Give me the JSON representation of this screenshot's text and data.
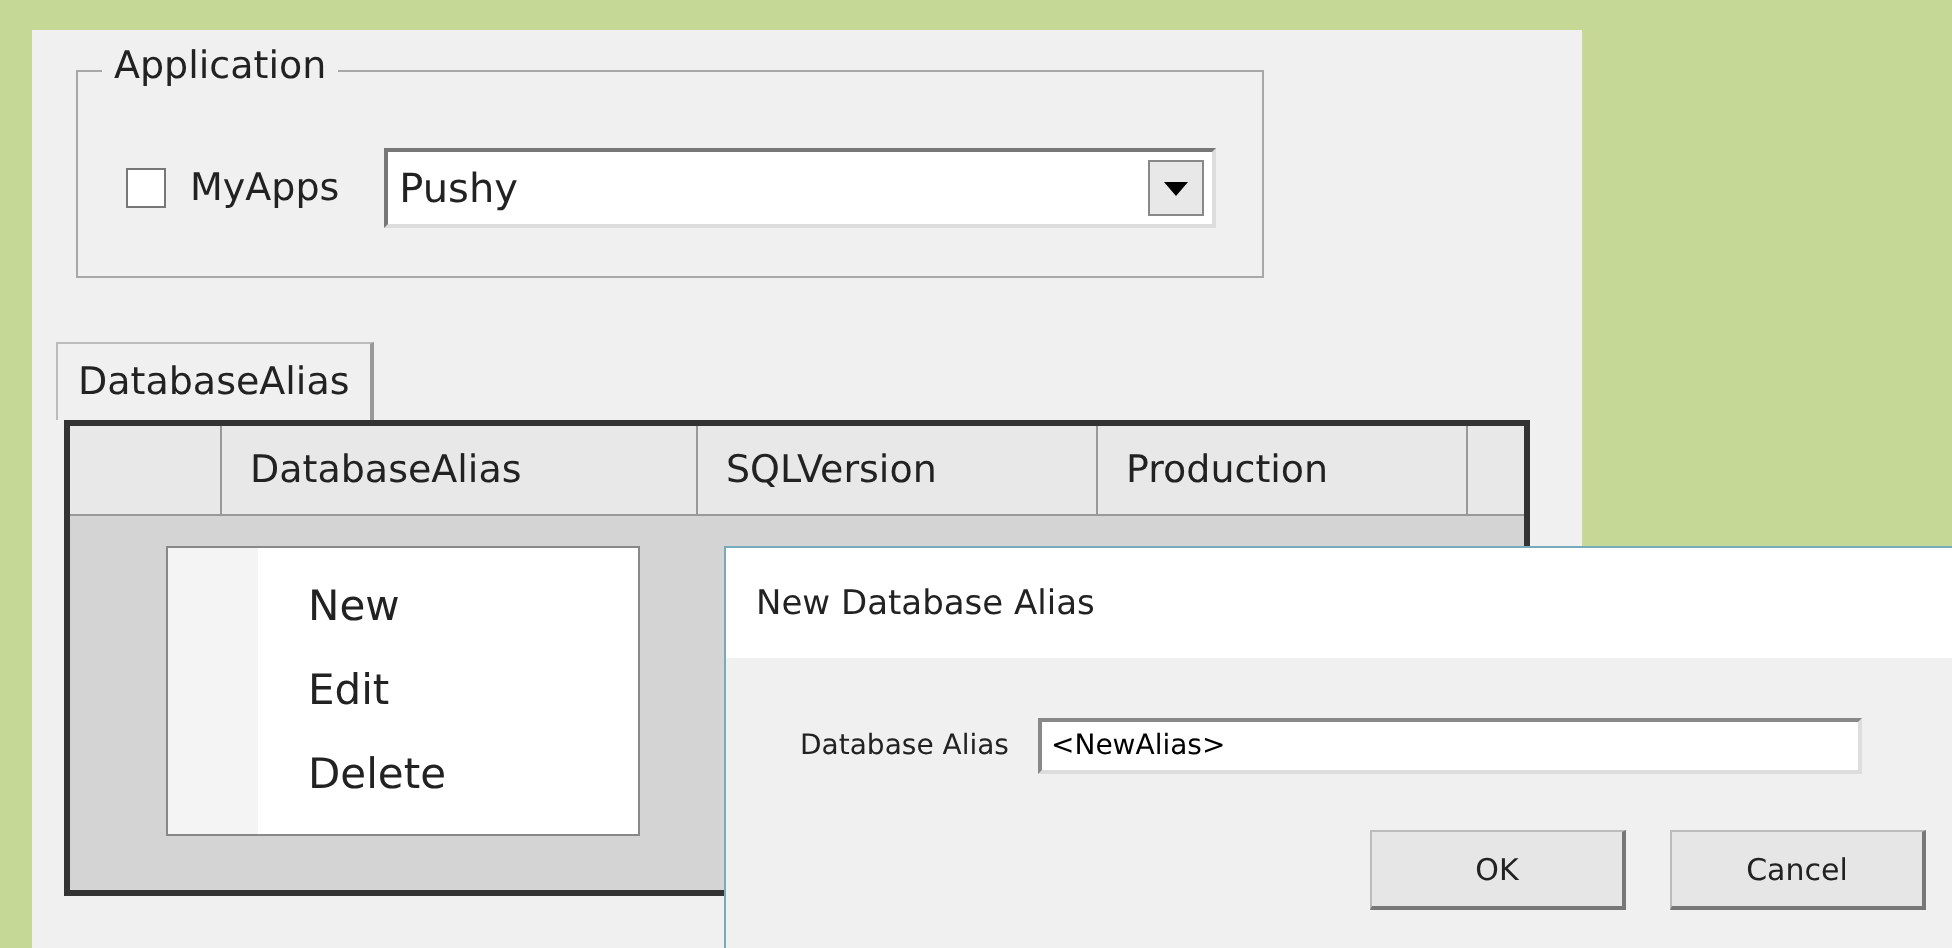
{
  "application_group": {
    "title": "Application",
    "myapps_checkbox": {
      "label": "MyApps",
      "checked": false
    },
    "app_combo": {
      "value": "Pushy"
    }
  },
  "tabs": [
    {
      "label": "DatabaseAlias",
      "selected": true
    }
  ],
  "grid": {
    "columns": [
      "DatabaseAlias",
      "SQLVersion",
      "Production"
    ]
  },
  "context_menu": {
    "items": [
      "New",
      "Edit",
      "Delete"
    ]
  },
  "dialog": {
    "title": "New Database Alias",
    "field": {
      "label": "Database Alias",
      "value": "<NewAlias>"
    },
    "buttons": [
      "OK",
      "Cancel"
    ]
  }
}
